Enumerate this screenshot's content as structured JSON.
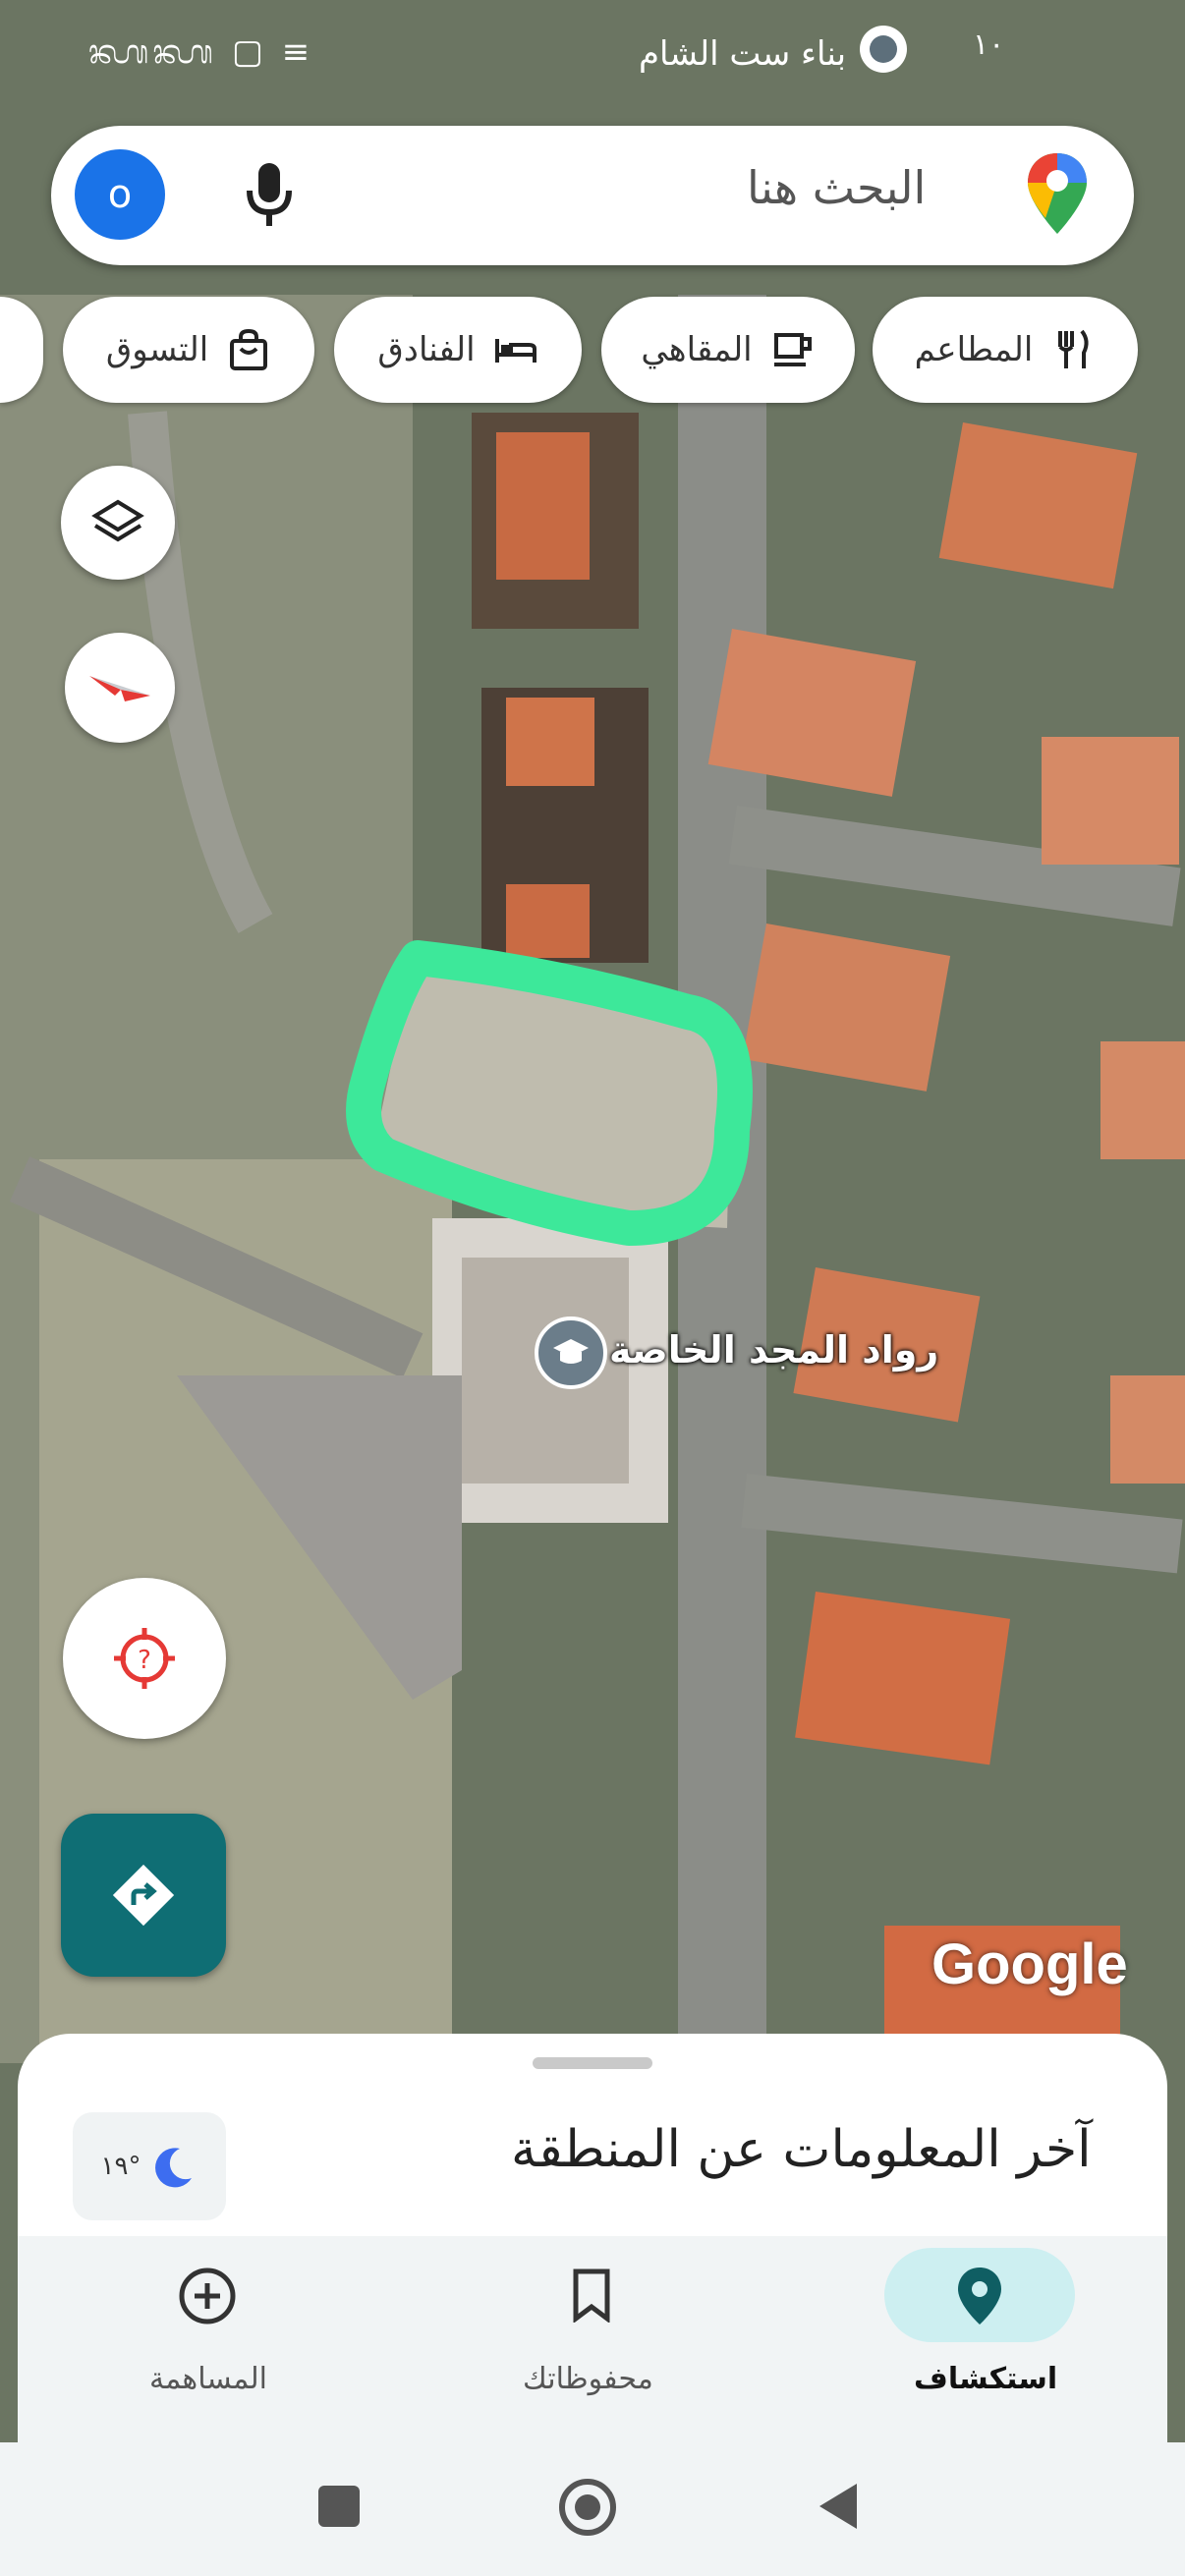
{
  "status_bar": {
    "left_icons": "ᭆᭆ ▢ ≡",
    "place_label": "بناء ست الشام",
    "right_text": "١٠"
  },
  "search": {
    "placeholder": "البحث هنا",
    "avatar_letter": "o"
  },
  "chips": [
    {
      "label": "المطاعم",
      "icon": "fork-knife-icon"
    },
    {
      "label": "المقاهي",
      "icon": "coffee-cup-icon"
    },
    {
      "label": "الفنادق",
      "icon": "bed-icon"
    },
    {
      "label": "التسوق",
      "icon": "shopping-bag-icon"
    }
  ],
  "map": {
    "poi_label": "رواد المجد الخاصة",
    "poi_icon": "school-icon",
    "watermark": "Google",
    "highlight_color": "#3de89a"
  },
  "sheet": {
    "title": "آخر المعلومات عن المنطقة",
    "weather_temp": "١٩°",
    "weather_icon": "moon-icon"
  },
  "bottom_nav": {
    "items": [
      {
        "label": "استكشاف",
        "icon": "location-pin-icon",
        "active": true
      },
      {
        "label": "محفوظاتك",
        "icon": "bookmark-icon",
        "active": false
      },
      {
        "label": "المساهمة",
        "icon": "add-circle-icon",
        "active": false
      }
    ]
  },
  "colors": {
    "accent": "#0f6e74",
    "active_pill": "#cdeff1",
    "avatar": "#1a73e8"
  }
}
